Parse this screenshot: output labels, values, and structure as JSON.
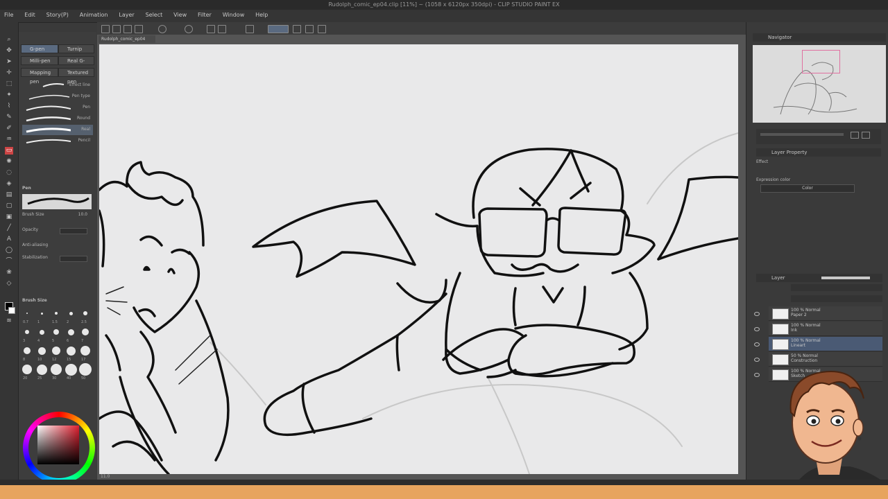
{
  "window": {
    "title": "Rudolph_comic_ep04.clip [11%] ~ (1058 x 6120px 350dpi) - CLIP STUDIO PAINT EX"
  },
  "menu": [
    "File",
    "Edit",
    "Story(P)",
    "Animation",
    "Layer",
    "Select",
    "View",
    "Filter",
    "Window",
    "Help"
  ],
  "subtool": {
    "tabs": [
      "G-pen",
      "Turnip",
      "Milli-pen",
      "Real G-pen",
      "Mapping pen",
      "Textured pen"
    ],
    "brushes": [
      "Effect line",
      "Pen type",
      "Pen",
      "Round",
      "Real",
      "Pencil"
    ]
  },
  "properties": {
    "heading": "Pen",
    "rows": [
      "Brush Size",
      "Opacity",
      "Anti-aliasing",
      "Stabilization"
    ],
    "brush_size": "10.0"
  },
  "brush_size_panel": {
    "heading": "Brush Size",
    "sizes": [
      "0.7",
      "1",
      "1.5",
      "2",
      "2.5",
      "3",
      "4",
      "5",
      "6",
      "7",
      "8",
      "10",
      "12",
      "15",
      "17",
      "20",
      "25",
      "30",
      "40",
      "50"
    ]
  },
  "canvas_tab": "Rudolph_comic_ep04",
  "navigator": {
    "heading": "Navigator"
  },
  "layer_property": {
    "heading": "Layer Property",
    "effect_label": "Effect",
    "expression_label": "Expression color",
    "expression_value": "Color"
  },
  "layers": {
    "heading": "Layer",
    "items": [
      {
        "name": "100 % Normal",
        "sub": "Paper 2",
        "selected": false
      },
      {
        "name": "100 % Normal",
        "sub": "Ink",
        "selected": false
      },
      {
        "name": "100 % Normal",
        "sub": "Lineart",
        "selected": true
      },
      {
        "name": "50 % Normal",
        "sub": "Construction",
        "selected": false
      },
      {
        "name": "100 % Normal",
        "sub": "Sketch",
        "selected": false
      }
    ]
  },
  "status": {
    "zoom": "11.0"
  },
  "colors": {
    "accent": "#5a6a80",
    "canvas": "#e9e9ea",
    "banner": "#e7a45e",
    "nav_frame": "#e070a0"
  }
}
